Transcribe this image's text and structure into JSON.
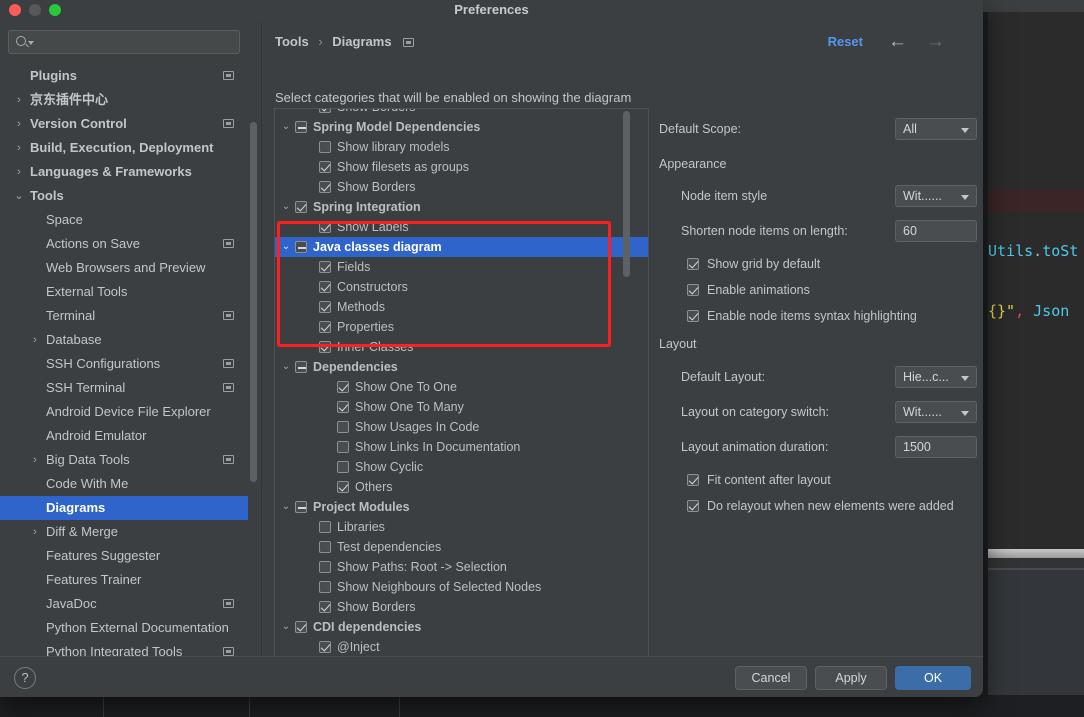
{
  "editor": {
    "line1_a": "Utils",
    "line1_dot": ".",
    "line1_b": "toSt",
    "line2_a": "{}\"",
    "line2_comma": ",",
    "line2_b": " Json"
  },
  "dialog": {
    "title": "Preferences"
  },
  "search": {
    "value": "",
    "placeholder": ""
  },
  "sidebar": {
    "items": [
      {
        "label": "Plugins",
        "level": 0,
        "chevron": "",
        "bold": true,
        "gear": true,
        "selected": false
      },
      {
        "label": "京东插件中心",
        "level": 0,
        "chevron": "›",
        "bold": true,
        "gear": false,
        "selected": false
      },
      {
        "label": "Version Control",
        "level": 0,
        "chevron": "›",
        "bold": true,
        "gear": true,
        "selected": false
      },
      {
        "label": "Build, Execution, Deployment",
        "level": 0,
        "chevron": "›",
        "bold": true,
        "gear": false,
        "selected": false
      },
      {
        "label": "Languages & Frameworks",
        "level": 0,
        "chevron": "›",
        "bold": true,
        "gear": false,
        "selected": false
      },
      {
        "label": "Tools",
        "level": 0,
        "chevron": "⌄",
        "bold": true,
        "gear": false,
        "selected": false
      },
      {
        "label": "Space",
        "level": 1,
        "chevron": "",
        "bold": false,
        "gear": false,
        "selected": false
      },
      {
        "label": "Actions on Save",
        "level": 1,
        "chevron": "",
        "bold": false,
        "gear": true,
        "selected": false
      },
      {
        "label": "Web Browsers and Preview",
        "level": 1,
        "chevron": "",
        "bold": false,
        "gear": false,
        "selected": false
      },
      {
        "label": "External Tools",
        "level": 1,
        "chevron": "",
        "bold": false,
        "gear": false,
        "selected": false
      },
      {
        "label": "Terminal",
        "level": 1,
        "chevron": "",
        "bold": false,
        "gear": true,
        "selected": false
      },
      {
        "label": "Database",
        "level": 1,
        "chevron": "›",
        "bold": false,
        "gear": false,
        "selected": false
      },
      {
        "label": "SSH Configurations",
        "level": 1,
        "chevron": "",
        "bold": false,
        "gear": true,
        "selected": false
      },
      {
        "label": "SSH Terminal",
        "level": 1,
        "chevron": "",
        "bold": false,
        "gear": true,
        "selected": false
      },
      {
        "label": "Android Device File Explorer",
        "level": 1,
        "chevron": "",
        "bold": false,
        "gear": false,
        "selected": false
      },
      {
        "label": "Android Emulator",
        "level": 1,
        "chevron": "",
        "bold": false,
        "gear": false,
        "selected": false
      },
      {
        "label": "Big Data Tools",
        "level": 1,
        "chevron": "›",
        "bold": false,
        "gear": true,
        "selected": false
      },
      {
        "label": "Code With Me",
        "level": 1,
        "chevron": "",
        "bold": false,
        "gear": false,
        "selected": false
      },
      {
        "label": "Diagrams",
        "level": 1,
        "chevron": "",
        "bold": false,
        "gear": false,
        "selected": true
      },
      {
        "label": "Diff & Merge",
        "level": 1,
        "chevron": "›",
        "bold": false,
        "gear": false,
        "selected": false
      },
      {
        "label": "Features Suggester",
        "level": 1,
        "chevron": "",
        "bold": false,
        "gear": false,
        "selected": false
      },
      {
        "label": "Features Trainer",
        "level": 1,
        "chevron": "",
        "bold": false,
        "gear": false,
        "selected": false
      },
      {
        "label": "JavaDoc",
        "level": 1,
        "chevron": "",
        "bold": false,
        "gear": true,
        "selected": false
      },
      {
        "label": "Python External Documentation",
        "level": 1,
        "chevron": "",
        "bold": false,
        "gear": false,
        "selected": false
      },
      {
        "label": "Python Integrated Tools",
        "level": 1,
        "chevron": "",
        "bold": false,
        "gear": true,
        "selected": false
      }
    ]
  },
  "breadcrumb": {
    "root": "Tools",
    "separator": "›",
    "current": "Diagrams"
  },
  "header": {
    "reset_label": "Reset",
    "back_arrow": "←",
    "forward_arrow": "→",
    "hint": "Select categories that will be enabled on showing the diagram"
  },
  "category_tree": {
    "rows": [
      {
        "label": "Show Borders",
        "depth": 1,
        "chevron": "",
        "check": "on",
        "parent": false,
        "selected": false
      },
      {
        "label": "Spring Model Dependencies",
        "depth": 0,
        "chevron": "⌄",
        "check": "mid",
        "parent": true,
        "selected": false
      },
      {
        "label": "Show library models",
        "depth": 1,
        "chevron": "",
        "check": "off",
        "parent": false,
        "selected": false
      },
      {
        "label": "Show filesets as groups",
        "depth": 1,
        "chevron": "",
        "check": "on",
        "parent": false,
        "selected": false
      },
      {
        "label": "Show Borders",
        "depth": 1,
        "chevron": "",
        "check": "on",
        "parent": false,
        "selected": false
      },
      {
        "label": "Spring Integration",
        "depth": 0,
        "chevron": "⌄",
        "check": "on",
        "parent": true,
        "selected": false
      },
      {
        "label": "Show Labels",
        "depth": 1,
        "chevron": "",
        "check": "on",
        "parent": false,
        "selected": false
      },
      {
        "label": "Java classes diagram",
        "depth": 0,
        "chevron": "⌄",
        "check": "mid",
        "parent": true,
        "selected": true
      },
      {
        "label": "Fields",
        "depth": 1,
        "chevron": "",
        "check": "on",
        "parent": false,
        "selected": false
      },
      {
        "label": "Constructors",
        "depth": 1,
        "chevron": "",
        "check": "on",
        "parent": false,
        "selected": false
      },
      {
        "label": "Methods",
        "depth": 1,
        "chevron": "",
        "check": "on",
        "parent": false,
        "selected": false
      },
      {
        "label": "Properties",
        "depth": 1,
        "chevron": "",
        "check": "on",
        "parent": false,
        "selected": false
      },
      {
        "label": "Inner Classes",
        "depth": 1,
        "chevron": "",
        "check": "on",
        "parent": false,
        "selected": false
      },
      {
        "label": "Dependencies",
        "depth": 0,
        "chevron": "⌄",
        "check": "mid",
        "parent": true,
        "selected": false
      },
      {
        "label": "Show One To One",
        "depth": 2,
        "chevron": "",
        "check": "on",
        "parent": false,
        "selected": false
      },
      {
        "label": "Show One To Many",
        "depth": 2,
        "chevron": "",
        "check": "on",
        "parent": false,
        "selected": false
      },
      {
        "label": "Show Usages In Code",
        "depth": 2,
        "chevron": "",
        "check": "off",
        "parent": false,
        "selected": false
      },
      {
        "label": "Show Links In Documentation",
        "depth": 2,
        "chevron": "",
        "check": "off",
        "parent": false,
        "selected": false
      },
      {
        "label": "Show Cyclic",
        "depth": 2,
        "chevron": "",
        "check": "off",
        "parent": false,
        "selected": false
      },
      {
        "label": "Others",
        "depth": 2,
        "chevron": "",
        "check": "on",
        "parent": false,
        "selected": false
      },
      {
        "label": "Project Modules",
        "depth": 0,
        "chevron": "⌄",
        "check": "mid",
        "parent": true,
        "selected": false
      },
      {
        "label": "Libraries",
        "depth": 1,
        "chevron": "",
        "check": "off",
        "parent": false,
        "selected": false
      },
      {
        "label": "Test dependencies",
        "depth": 1,
        "chevron": "",
        "check": "off",
        "parent": false,
        "selected": false
      },
      {
        "label": "Show Paths: Root -> Selection",
        "depth": 1,
        "chevron": "",
        "check": "off",
        "parent": false,
        "selected": false
      },
      {
        "label": "Show Neighbours of Selected Nodes",
        "depth": 1,
        "chevron": "",
        "check": "off",
        "parent": false,
        "selected": false
      },
      {
        "label": "Show Borders",
        "depth": 1,
        "chevron": "",
        "check": "on",
        "parent": false,
        "selected": false
      },
      {
        "label": "CDI dependencies",
        "depth": 0,
        "chevron": "⌄",
        "check": "on",
        "parent": true,
        "selected": false
      },
      {
        "label": "@Inject",
        "depth": 1,
        "chevron": "",
        "check": "on",
        "parent": false,
        "selected": false
      }
    ]
  },
  "settings": {
    "default_scope_label": "Default Scope:",
    "default_scope_value": "All",
    "appearance_header": "Appearance",
    "node_item_style_label": "Node item style",
    "node_item_style_value": "Wit......",
    "shorten_label": "Shorten node items on length:",
    "shorten_value": "60",
    "show_grid_label": "Show grid by default",
    "enable_animations_label": "Enable animations",
    "syntax_highlight_label": "Enable node items syntax highlighting",
    "layout_header": "Layout",
    "default_layout_label": "Default Layout:",
    "default_layout_value": "Hie...c...",
    "layout_switch_label": "Layout on category switch:",
    "layout_switch_value": "Wit......",
    "layout_duration_label": "Layout animation duration:",
    "layout_duration_value": "1500",
    "fit_content_label": "Fit content after layout",
    "relayout_label": "Do relayout when new elements were added"
  },
  "footer": {
    "help_label": "?",
    "cancel_label": "Cancel",
    "apply_label": "Apply",
    "ok_label": "OK"
  },
  "colors": {
    "accent_selection": "#2f65ca",
    "link_blue": "#5596f0",
    "annotation_red": "#ff1f1f",
    "ok_button": "#3b6ea8"
  }
}
